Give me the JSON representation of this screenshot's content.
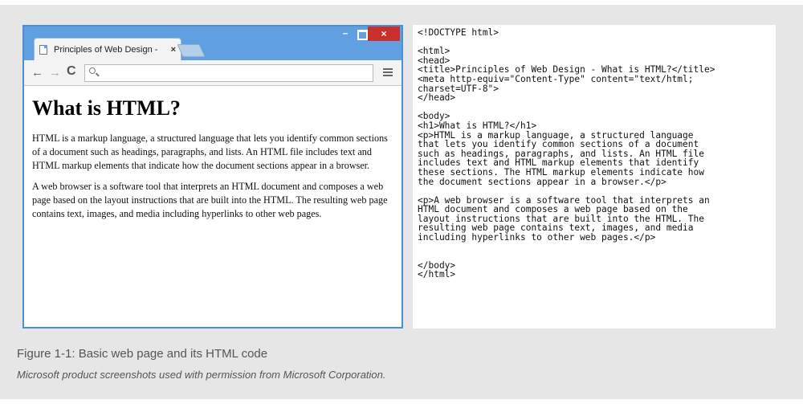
{
  "browser": {
    "tab_title": "Principles of Web Design -",
    "tab_close": "×",
    "min_label": "–",
    "close_label": "×",
    "nav": {
      "back": "←",
      "forward": "→",
      "reload": "C"
    },
    "menu_icon": "hamburger-menu-icon"
  },
  "page": {
    "heading": "What is HTML?",
    "paragraphs": [
      "HTML is a markup language, a structured language that lets you identify common sections of a document such as headings, paragraphs, and lists. An HTML file includes text and HTML markup elements that indicate how the document sections appear in a browser.",
      "A web browser is a software tool that interprets an HTML document and composes a web page based on the layout instructions that are built into the HTML. The resulting web page contains text, images, and media including hyperlinks to other web pages."
    ]
  },
  "code": {
    "source": "<!DOCTYPE html>\n\n<html>\n<head>\n<title>Principles of Web Design - What is HTML?</title>\n<meta http-equiv=\"Content-Type\" content=\"text/html;\ncharset=UTF-8\">\n</head>\n\n<body>\n<h1>What is HTML?</h1>\n<p>HTML is a markup language, a structured language\nthat lets you identify common sections of a document\nsuch as headings, paragraphs, and lists. An HTML file\nincludes text and HTML markup elements that identify\nthese sections. The HTML markup elements indicate how\nthe document sections appear in a browser.</p>\n\n<p>A web browser is a software tool that interprets an\nHTML document and composes a web page based on the\nlayout instructions that are built into the HTML. The\nresulting web page contains text, images, and media\nincluding hyperlinks to other web pages.</p>\n\n\n</body>\n</html>"
  },
  "caption": "Figure 1-1: Basic web page and its HTML code",
  "credit": "Microsoft product screenshots used with permission from Microsoft Corporation.",
  "colors": {
    "titlebar": "#61a0e0",
    "close_button": "#c9302c",
    "background": "#e6e6e6"
  }
}
